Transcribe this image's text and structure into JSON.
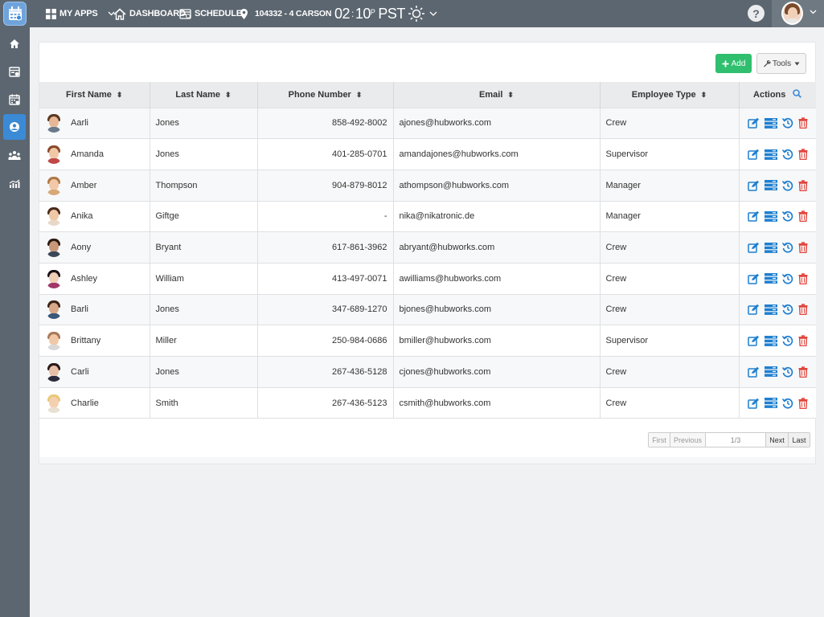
{
  "header": {
    "my_apps": "MY APPS",
    "dashboard": "DASHBOARD",
    "schedule": "SCHEDULE",
    "location": "104332 - 4 CARSON",
    "clock_hours": "02",
    "clock_minutes": "10",
    "clock_suffix": "P",
    "clock_tz": "PST",
    "help_glyph": "?"
  },
  "toolbar": {
    "add_label": "Add",
    "tools_label": "Tools"
  },
  "table": {
    "headers": {
      "first_name": "First Name",
      "last_name": "Last Name",
      "phone": "Phone Number",
      "email": "Email",
      "employee_type": "Employee Type",
      "actions": "Actions"
    },
    "rows": [
      {
        "first": "Aarli",
        "last": "Jones",
        "phone": "858-492-8002",
        "email": "ajones@hubworks.com",
        "type": "Crew",
        "hair": "#5a3a22",
        "skin": "#e8b896",
        "shirt": "#6a7a8a"
      },
      {
        "first": "Amanda",
        "last": "Jones",
        "phone": "401-285-0701",
        "email": "amandajones@hubworks.com",
        "type": "Supervisor",
        "hair": "#8a4a2a",
        "skin": "#f0c8a8",
        "shirt": "#c04848"
      },
      {
        "first": "Amber",
        "last": "Thompson",
        "phone": "904-879-8012",
        "email": "athompson@hubworks.com",
        "type": "Manager",
        "hair": "#b07848",
        "skin": "#f2c8a8",
        "shirt": "#d8a878"
      },
      {
        "first": "Anika",
        "last": "Giftge",
        "phone": "-",
        "email": "nika@nikatronic.de",
        "type": "Manager",
        "hair": "#4a2a1a",
        "skin": "#f0c8a8",
        "shirt": "#e8d8c8"
      },
      {
        "first": "Aony",
        "last": "Bryant",
        "phone": "617-861-3962",
        "email": "abryant@hubworks.com",
        "type": "Crew",
        "hair": "#2a1a12",
        "skin": "#c89878",
        "shirt": "#3a4858"
      },
      {
        "first": "Ashley",
        "last": "William",
        "phone": "413-497-0071",
        "email": "awilliams@hubworks.com",
        "type": "Crew",
        "hair": "#1a1218",
        "skin": "#f0d0b8",
        "shirt": "#a03868"
      },
      {
        "first": "Barli",
        "last": "Jones",
        "phone": "347-689-1270",
        "email": "bjones@hubworks.com",
        "type": "Crew",
        "hair": "#3a2418",
        "skin": "#d8a888",
        "shirt": "#3a5878"
      },
      {
        "first": "Brittany",
        "last": "Miller",
        "phone": "250-984-0686",
        "email": "bmiller@hubworks.com",
        "type": "Supervisor",
        "hair": "#a87a58",
        "skin": "#f0c8a8",
        "shirt": "#d8d8d8"
      },
      {
        "first": "Carli",
        "last": "Jones",
        "phone": "267-436-5128",
        "email": "cjones@hubworks.com",
        "type": "Crew",
        "hair": "#2a1a1a",
        "skin": "#e8c0a8",
        "shirt": "#2a2a3a"
      },
      {
        "first": "Charlie",
        "last": "Smith",
        "phone": "267-436-5123",
        "email": "csmith@hubworks.com",
        "type": "Crew",
        "hair": "#e8c878",
        "skin": "#f4d0b0",
        "shirt": "#e8e0d0"
      }
    ]
  },
  "pagination": {
    "first": "First",
    "previous": "Previous",
    "page": "1/3",
    "next": "Next",
    "last": "Last"
  },
  "colors": {
    "topbar": "#5c6670",
    "accent_blue": "#3b8ad6",
    "add_green": "#2fbf6e",
    "edit_blue": "#1f7fd0",
    "delete_red": "#e0443c"
  },
  "icons": {
    "sidebar": [
      "home-icon",
      "timesheet-icon",
      "calendar-icon",
      "employee-icon",
      "team-icon",
      "reports-icon"
    ],
    "row_actions": [
      "edit-icon",
      "details-icon",
      "history-icon",
      "delete-icon"
    ]
  }
}
